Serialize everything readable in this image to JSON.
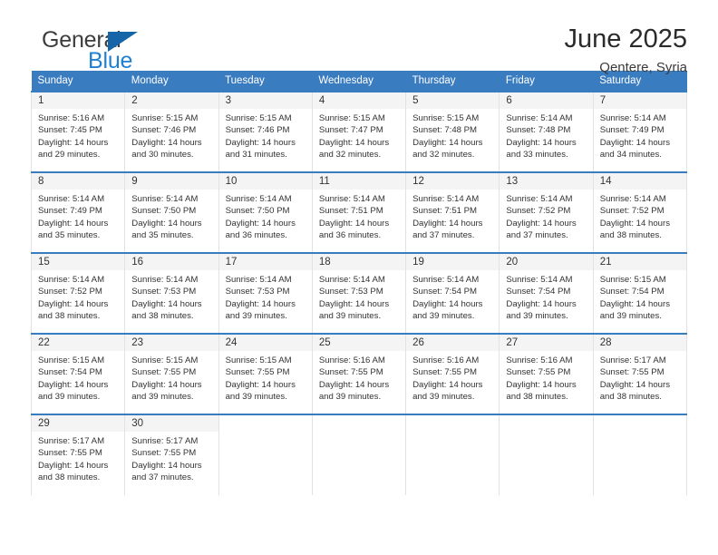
{
  "brand": {
    "name_part1": "General",
    "name_part2": "Blue",
    "triangle_icon": "triangle-icon",
    "accent_blue": "#1f7fd0",
    "logo_dark": "#3d3d3d"
  },
  "header": {
    "title": "June 2025",
    "location": "Qentere, Syria"
  },
  "theme": {
    "header_blue": "#3a7cc0",
    "daynum_bg": "#f4f4f4",
    "cell_border": "#e2e2e2"
  },
  "weekdays": [
    "Sunday",
    "Monday",
    "Tuesday",
    "Wednesday",
    "Thursday",
    "Friday",
    "Saturday"
  ],
  "weeks": [
    [
      {
        "day": "1",
        "sunrise": "Sunrise: 5:16 AM",
        "sunset": "Sunset: 7:45 PM",
        "daylight1": "Daylight: 14 hours",
        "daylight2": "and 29 minutes."
      },
      {
        "day": "2",
        "sunrise": "Sunrise: 5:15 AM",
        "sunset": "Sunset: 7:46 PM",
        "daylight1": "Daylight: 14 hours",
        "daylight2": "and 30 minutes."
      },
      {
        "day": "3",
        "sunrise": "Sunrise: 5:15 AM",
        "sunset": "Sunset: 7:46 PM",
        "daylight1": "Daylight: 14 hours",
        "daylight2": "and 31 minutes."
      },
      {
        "day": "4",
        "sunrise": "Sunrise: 5:15 AM",
        "sunset": "Sunset: 7:47 PM",
        "daylight1": "Daylight: 14 hours",
        "daylight2": "and 32 minutes."
      },
      {
        "day": "5",
        "sunrise": "Sunrise: 5:15 AM",
        "sunset": "Sunset: 7:48 PM",
        "daylight1": "Daylight: 14 hours",
        "daylight2": "and 32 minutes."
      },
      {
        "day": "6",
        "sunrise": "Sunrise: 5:14 AM",
        "sunset": "Sunset: 7:48 PM",
        "daylight1": "Daylight: 14 hours",
        "daylight2": "and 33 minutes."
      },
      {
        "day": "7",
        "sunrise": "Sunrise: 5:14 AM",
        "sunset": "Sunset: 7:49 PM",
        "daylight1": "Daylight: 14 hours",
        "daylight2": "and 34 minutes."
      }
    ],
    [
      {
        "day": "8",
        "sunrise": "Sunrise: 5:14 AM",
        "sunset": "Sunset: 7:49 PM",
        "daylight1": "Daylight: 14 hours",
        "daylight2": "and 35 minutes."
      },
      {
        "day": "9",
        "sunrise": "Sunrise: 5:14 AM",
        "sunset": "Sunset: 7:50 PM",
        "daylight1": "Daylight: 14 hours",
        "daylight2": "and 35 minutes."
      },
      {
        "day": "10",
        "sunrise": "Sunrise: 5:14 AM",
        "sunset": "Sunset: 7:50 PM",
        "daylight1": "Daylight: 14 hours",
        "daylight2": "and 36 minutes."
      },
      {
        "day": "11",
        "sunrise": "Sunrise: 5:14 AM",
        "sunset": "Sunset: 7:51 PM",
        "daylight1": "Daylight: 14 hours",
        "daylight2": "and 36 minutes."
      },
      {
        "day": "12",
        "sunrise": "Sunrise: 5:14 AM",
        "sunset": "Sunset: 7:51 PM",
        "daylight1": "Daylight: 14 hours",
        "daylight2": "and 37 minutes."
      },
      {
        "day": "13",
        "sunrise": "Sunrise: 5:14 AM",
        "sunset": "Sunset: 7:52 PM",
        "daylight1": "Daylight: 14 hours",
        "daylight2": "and 37 minutes."
      },
      {
        "day": "14",
        "sunrise": "Sunrise: 5:14 AM",
        "sunset": "Sunset: 7:52 PM",
        "daylight1": "Daylight: 14 hours",
        "daylight2": "and 38 minutes."
      }
    ],
    [
      {
        "day": "15",
        "sunrise": "Sunrise: 5:14 AM",
        "sunset": "Sunset: 7:52 PM",
        "daylight1": "Daylight: 14 hours",
        "daylight2": "and 38 minutes."
      },
      {
        "day": "16",
        "sunrise": "Sunrise: 5:14 AM",
        "sunset": "Sunset: 7:53 PM",
        "daylight1": "Daylight: 14 hours",
        "daylight2": "and 38 minutes."
      },
      {
        "day": "17",
        "sunrise": "Sunrise: 5:14 AM",
        "sunset": "Sunset: 7:53 PM",
        "daylight1": "Daylight: 14 hours",
        "daylight2": "and 39 minutes."
      },
      {
        "day": "18",
        "sunrise": "Sunrise: 5:14 AM",
        "sunset": "Sunset: 7:53 PM",
        "daylight1": "Daylight: 14 hours",
        "daylight2": "and 39 minutes."
      },
      {
        "day": "19",
        "sunrise": "Sunrise: 5:14 AM",
        "sunset": "Sunset: 7:54 PM",
        "daylight1": "Daylight: 14 hours",
        "daylight2": "and 39 minutes."
      },
      {
        "day": "20",
        "sunrise": "Sunrise: 5:14 AM",
        "sunset": "Sunset: 7:54 PM",
        "daylight1": "Daylight: 14 hours",
        "daylight2": "and 39 minutes."
      },
      {
        "day": "21",
        "sunrise": "Sunrise: 5:15 AM",
        "sunset": "Sunset: 7:54 PM",
        "daylight1": "Daylight: 14 hours",
        "daylight2": "and 39 minutes."
      }
    ],
    [
      {
        "day": "22",
        "sunrise": "Sunrise: 5:15 AM",
        "sunset": "Sunset: 7:54 PM",
        "daylight1": "Daylight: 14 hours",
        "daylight2": "and 39 minutes."
      },
      {
        "day": "23",
        "sunrise": "Sunrise: 5:15 AM",
        "sunset": "Sunset: 7:55 PM",
        "daylight1": "Daylight: 14 hours",
        "daylight2": "and 39 minutes."
      },
      {
        "day": "24",
        "sunrise": "Sunrise: 5:15 AM",
        "sunset": "Sunset: 7:55 PM",
        "daylight1": "Daylight: 14 hours",
        "daylight2": "and 39 minutes."
      },
      {
        "day": "25",
        "sunrise": "Sunrise: 5:16 AM",
        "sunset": "Sunset: 7:55 PM",
        "daylight1": "Daylight: 14 hours",
        "daylight2": "and 39 minutes."
      },
      {
        "day": "26",
        "sunrise": "Sunrise: 5:16 AM",
        "sunset": "Sunset: 7:55 PM",
        "daylight1": "Daylight: 14 hours",
        "daylight2": "and 39 minutes."
      },
      {
        "day": "27",
        "sunrise": "Sunrise: 5:16 AM",
        "sunset": "Sunset: 7:55 PM",
        "daylight1": "Daylight: 14 hours",
        "daylight2": "and 38 minutes."
      },
      {
        "day": "28",
        "sunrise": "Sunrise: 5:17 AM",
        "sunset": "Sunset: 7:55 PM",
        "daylight1": "Daylight: 14 hours",
        "daylight2": "and 38 minutes."
      }
    ],
    [
      {
        "day": "29",
        "sunrise": "Sunrise: 5:17 AM",
        "sunset": "Sunset: 7:55 PM",
        "daylight1": "Daylight: 14 hours",
        "daylight2": "and 38 minutes."
      },
      {
        "day": "30",
        "sunrise": "Sunrise: 5:17 AM",
        "sunset": "Sunset: 7:55 PM",
        "daylight1": "Daylight: 14 hours",
        "daylight2": "and 37 minutes."
      },
      {
        "day": "",
        "sunrise": "",
        "sunset": "",
        "daylight1": "",
        "daylight2": ""
      },
      {
        "day": "",
        "sunrise": "",
        "sunset": "",
        "daylight1": "",
        "daylight2": ""
      },
      {
        "day": "",
        "sunrise": "",
        "sunset": "",
        "daylight1": "",
        "daylight2": ""
      },
      {
        "day": "",
        "sunrise": "",
        "sunset": "",
        "daylight1": "",
        "daylight2": ""
      },
      {
        "day": "",
        "sunrise": "",
        "sunset": "",
        "daylight1": "",
        "daylight2": ""
      }
    ]
  ]
}
